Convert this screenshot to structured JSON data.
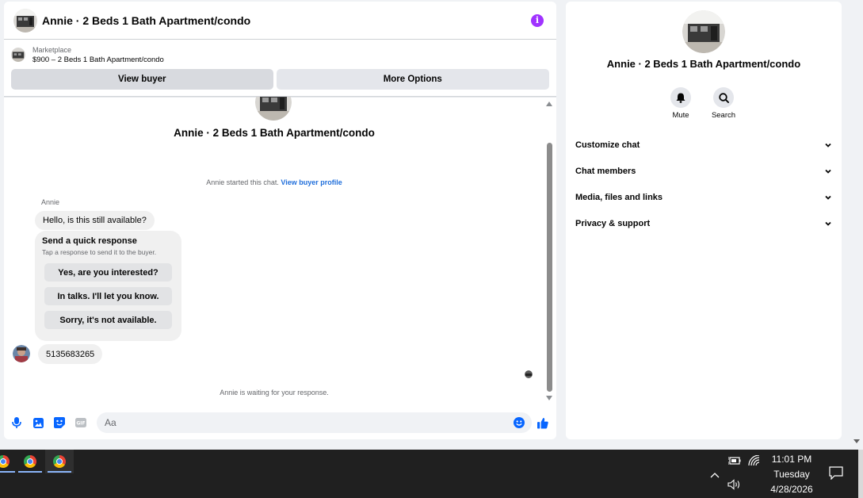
{
  "header": {
    "title": "Annie · 2 Beds 1 Bath Apartment/condo",
    "info_icon": "info-icon",
    "accent_color": "#a033ff"
  },
  "listing": {
    "category": "Marketplace",
    "price_title": "$900 – 2 Beds 1 Bath Apartment/condo"
  },
  "actions": {
    "view_buyer": "View buyer",
    "more_options": "More Options"
  },
  "conversation": {
    "hero_title": "Annie · 2 Beds 1 Bath Apartment/condo",
    "started_text": "Annie started this chat.",
    "started_link": "View buyer profile",
    "sender_name": "Annie",
    "incoming_message": "Hello, is this still available?",
    "quick_response": {
      "title": "Send a quick response",
      "subtitle": "Tap a response to send it to the buyer.",
      "options": [
        "Yes, are you interested?",
        "In talks. I'll let you know.",
        "Sorry, it's not available."
      ]
    },
    "outgoing_message": "5135683265",
    "waiting_text": "Annie is waiting for your response."
  },
  "composer": {
    "placeholder": "Aa",
    "icons": [
      "microphone-icon",
      "image-icon",
      "sticker-icon",
      "gif-icon",
      "emoji-icon",
      "thumbs-up-icon"
    ],
    "accent_color": "#0866ff"
  },
  "info_panel": {
    "title": "Annie · 2 Beds 1 Bath Apartment/condo",
    "buttons": [
      {
        "label": "Mute",
        "icon": "bell-icon"
      },
      {
        "label": "Search",
        "icon": "search-icon"
      }
    ],
    "sections": [
      "Customize chat",
      "Chat members",
      "Media, files and links",
      "Privacy & support"
    ]
  },
  "taskbar": {
    "apps": [
      "chrome-icon",
      "chrome-icon",
      "chrome-icon"
    ],
    "time": "11:01 PM",
    "day": "Tuesday",
    "date": "4/28/2026",
    "tray_icons": [
      "battery-icon",
      "wifi-icon",
      "chevron-up-icon",
      "volume-icon",
      "notification-icon"
    ]
  }
}
